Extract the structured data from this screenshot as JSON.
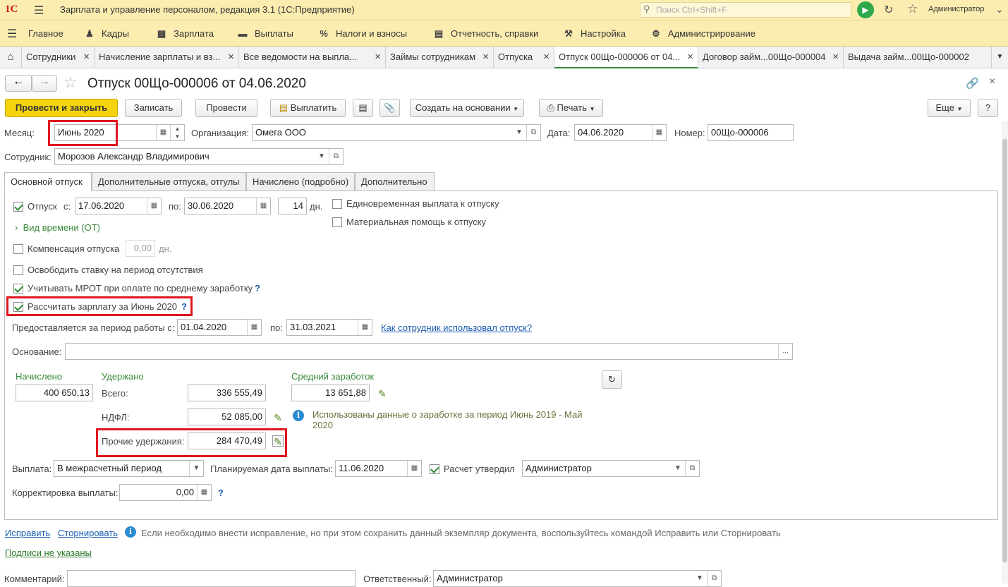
{
  "app": {
    "title": "Зарплата и управление персоналом, редакция 3.1  (1С:Предприятие)",
    "logo": "1С",
    "search_placeholder": "Поиск Ctrl+Shift+F",
    "user": "Администратор"
  },
  "menu": [
    "Главное",
    "Кадры",
    "Зарплата",
    "Выплаты",
    "Налоги и взносы",
    "Отчетность, справки",
    "Настройка",
    "Администрирование"
  ],
  "tabs": [
    "Сотрудники",
    "Начисление зарплаты и вз...",
    "Все ведомости на выпла...",
    "Займы сотрудникам",
    "Отпуска",
    "Отпуск 00Що-000006 от 04...",
    "Договор займ...00Що-000004",
    "Выдача займ...00Що-000002"
  ],
  "doc": {
    "title": "Отпуск 00Що-000006 от 04.06.2020"
  },
  "toolbar": {
    "post_close": "Провести и закрыть",
    "save": "Записать",
    "post": "Провести",
    "pay": "Выплатить",
    "create_based": "Создать на основании",
    "print": "Печать",
    "more": "Еще",
    "help": "?"
  },
  "header": {
    "month_label": "Месяц:",
    "month": "Июнь 2020",
    "org_label": "Организация:",
    "org": "Омега ООО",
    "date_label": "Дата:",
    "date": "04.06.2020",
    "number_label": "Номер:",
    "number": "00Що-000006",
    "employee_label": "Сотрудник:",
    "employee": "Морозов Александр Владимирович"
  },
  "form_tabs": [
    "Основной отпуск",
    "Дополнительные отпуска, отгулы",
    "Начислено (подробно)",
    "Дополнительно"
  ],
  "main": {
    "vacation_label": "Отпуск",
    "from_label": "с:",
    "from": "17.06.2020",
    "to_label": "по:",
    "to": "30.06.2020",
    "days": "14",
    "days_unit": "дн.",
    "lump_sum": "Единовременная выплата к отпуску",
    "material_aid": "Материальная помощь к отпуску",
    "time_type": "Вид времени (ОТ)",
    "compensation": "Компенсация отпуска",
    "comp_days": "0,00",
    "comp_unit": "дн.",
    "free_rate": "Освободить ставку на период отсутствия",
    "mrot": "Учитывать МРОТ при оплате по среднему заработку",
    "calc_salary": "Рассчитать зарплату за Июнь 2020",
    "period_label": "Предоставляется за период работы с:",
    "period_from": "01.04.2020",
    "period_to_label": "по:",
    "period_to": "31.03.2021",
    "usage_link": "Как сотрудник использовал отпуск?",
    "basis_label": "Основание:",
    "basis": "",
    "accrued_label": "Начислено",
    "accrued": "400 650,13",
    "withheld_label": "Удержано",
    "total_label": "Всего:",
    "total": "336 555,49",
    "ndfl_label": "НДФЛ:",
    "ndfl": "52 085,00",
    "other_label": "Прочие удержания:",
    "other": "284 470,49",
    "avg_label": "Средний заработок",
    "avg": "13 651,88",
    "avg_info": "Использованы данные о заработке за период Июнь 2019 - Май 2020",
    "payout_label": "Выплата:",
    "payout": "В межрасчетный период",
    "plan_date_label": "Планируемая дата выплаты:",
    "plan_date": "11.06.2020",
    "approved_label": "Расчет утвердил",
    "approved_by": "Администратор",
    "correction_label": "Корректировка выплаты:",
    "correction": "0,00"
  },
  "footer": {
    "fix": "Исправить",
    "storno": "Сторнировать",
    "fix_info": "Если необходимо внести исправление, но при этом сохранить данный экземпляр документа, воспользуйтесь командой Исправить или Сторнировать",
    "signatures": "Подписи не указаны",
    "comment_label": "Комментарий:",
    "responsible_label": "Ответственный:",
    "responsible": "Администратор"
  }
}
